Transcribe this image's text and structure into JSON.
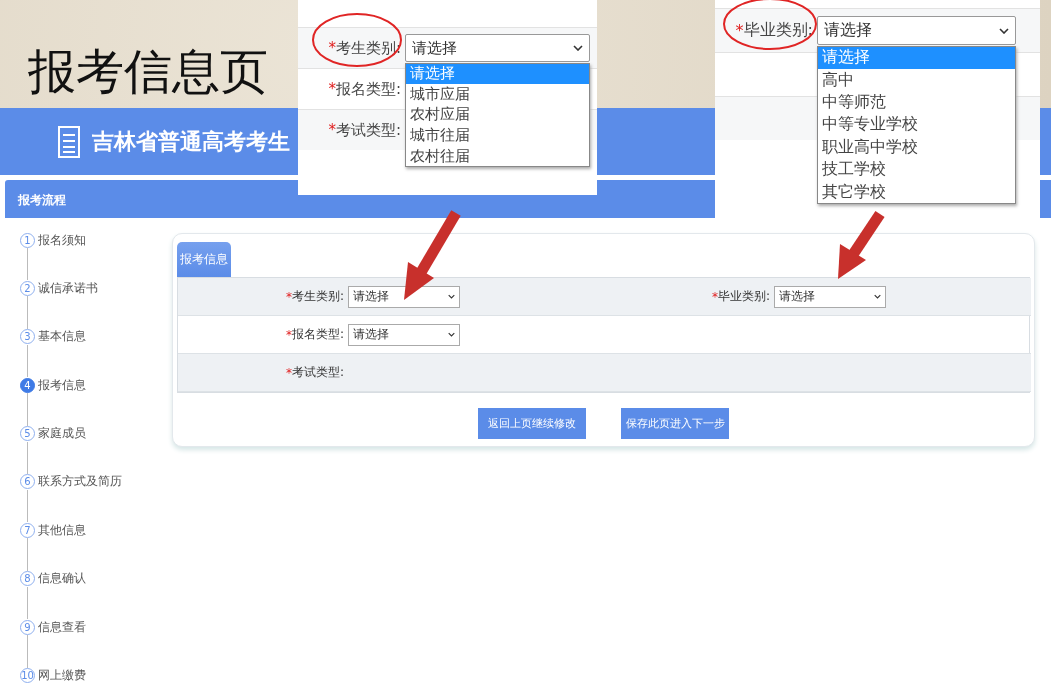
{
  "slide_title": "报考信息页",
  "header": {
    "site_title": "吉林省普通高考考生"
  },
  "sidebar": {
    "title": "报考流程",
    "steps": [
      {
        "number": "1",
        "label": "报名须知",
        "selected": false
      },
      {
        "number": "2",
        "label": "诚信承诺书",
        "selected": false
      },
      {
        "number": "3",
        "label": "基本信息",
        "selected": false
      },
      {
        "number": "4",
        "label": "报考信息",
        "selected": true
      },
      {
        "number": "5",
        "label": "家庭成员",
        "selected": false
      },
      {
        "number": "6",
        "label": "联系方式及简历",
        "selected": false
      },
      {
        "number": "7",
        "label": "其他信息",
        "selected": false
      },
      {
        "number": "8",
        "label": "信息确认",
        "selected": false
      },
      {
        "number": "9",
        "label": "信息查看",
        "selected": false
      },
      {
        "number": "10",
        "label": "网上缴费",
        "selected": false
      }
    ]
  },
  "form_card": {
    "tab": "报考信息",
    "fields": [
      {
        "mark": "*",
        "label": "考生类别:",
        "kind": "select",
        "value": "请选择"
      },
      {
        "mark": "*",
        "label": "毕业类别:",
        "kind": "select",
        "value": "请选择"
      },
      {
        "mark": "*",
        "label": "报名类型:",
        "kind": "select",
        "value": "请选择"
      },
      {
        "mark": "*",
        "label": "考试类型:",
        "kind": "empty"
      }
    ],
    "buttons": [
      "返回上页继续修改",
      "保存此页进入下一步"
    ]
  },
  "zoom_insets": [
    {
      "fields": [
        {
          "mark": "*",
          "label": "考生类别:",
          "kind": "select",
          "value": "请选择",
          "options": [
            {
              "label": "请选择",
              "selected": true
            },
            {
              "label": "城市应届",
              "selected": false
            },
            {
              "label": "农村应届",
              "selected": false
            },
            {
              "label": "城市往届",
              "selected": false
            },
            {
              "label": "农村往届",
              "selected": false
            }
          ]
        },
        {
          "mark": "*",
          "label": "报名类型:",
          "kind": "empty"
        },
        {
          "mark": "*",
          "label": "考试类型:",
          "kind": "empty"
        }
      ]
    },
    {
      "fields": [
        {
          "mark": "*",
          "label": "毕业类别:",
          "kind": "select",
          "value": "请选择",
          "options": [
            {
              "label": "请选择",
              "selected": true
            },
            {
              "label": "高中",
              "selected": false
            },
            {
              "label": "中等师范",
              "selected": false
            },
            {
              "label": "中等专业学校",
              "selected": false
            },
            {
              "label": "职业高中学校",
              "selected": false
            },
            {
              "label": "技工学校",
              "selected": false
            },
            {
              "label": "其它学校",
              "selected": false
            }
          ]
        }
      ]
    }
  ]
}
